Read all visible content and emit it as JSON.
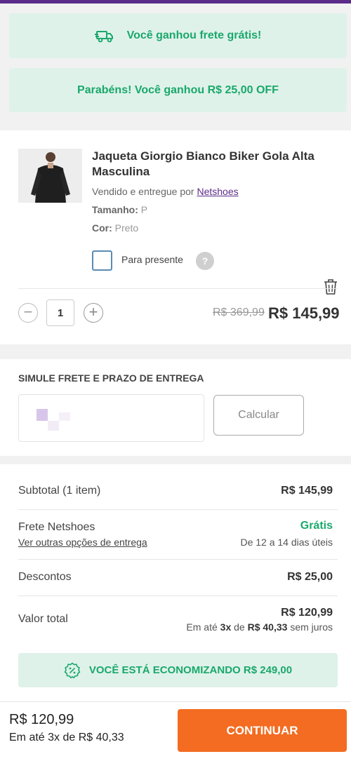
{
  "banners": {
    "free_shipping": "Você ganhou frete grátis!",
    "discount": "Parabéns! Você ganhou R$ 25,00 OFF"
  },
  "product": {
    "name_line1": "Jaqueta Giorgio Bianco Biker Gola Alta",
    "name_line2": "Masculina",
    "sold_by_prefix": "Vendido e entregue por",
    "seller": "Netshoes",
    "size_label": "Tamanho:",
    "size_value": "P",
    "color_label": "Cor:",
    "color_value": "Preto",
    "gift_label": "Para presente",
    "help_symbol": "?",
    "quantity": "1",
    "minus_symbol": "−",
    "plus_symbol": "+",
    "old_price": "R$ 369,99",
    "price": "R$ 145,99"
  },
  "shipping": {
    "title": "SIMULE FRETE E PRAZO DE ENTREGA",
    "button": "Calcular"
  },
  "summary": {
    "subtotal_label": "Subtotal (1 item)",
    "subtotal_value": "R$ 145,99",
    "freight_label": "Frete Netshoes",
    "freight_link": "Ver outras opções de entrega",
    "freight_value": "Grátis",
    "freight_days": "De 12 a 14 dias úteis",
    "discounts_label": "Descontos",
    "discounts_value": "R$ 25,00",
    "total_label": "Valor total",
    "total_value": "R$ 120,99",
    "installments_prefix": "Em até",
    "installments_count": "3x",
    "installments_mid": "de",
    "installments_amount": "R$ 40,33",
    "installments_suffix": "sem juros",
    "savings": "VOCÊ ESTÁ ECONOMIZANDO R$ 249,00"
  },
  "footer": {
    "price": "R$ 120,99",
    "installments": "Em até 3x de R$ 40,33",
    "cta": "CONTINUAR"
  },
  "colors": {
    "brand_purple": "#5b2b8a",
    "success_green": "#1aa86b",
    "banner_bg": "#dff2ea",
    "cta_orange": "#f36c21"
  },
  "icons": {
    "truck": "truck-icon",
    "trash": "trash-icon",
    "percent": "percent-badge-icon"
  }
}
